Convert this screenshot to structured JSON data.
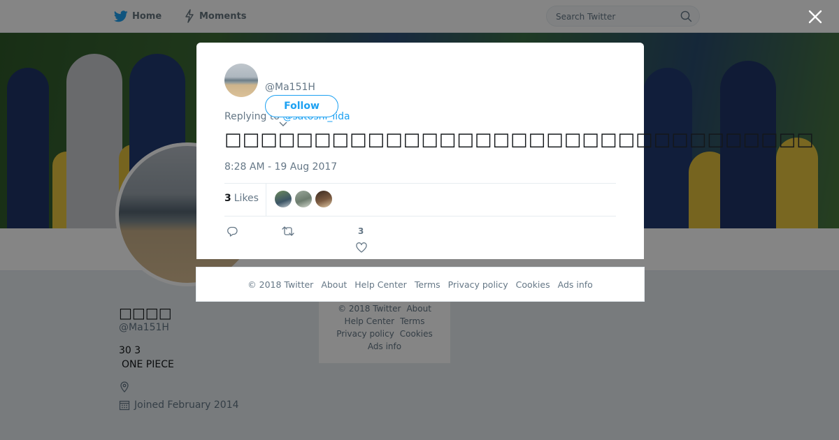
{
  "nav": {
    "home_label": "Home",
    "moments_label": "Moments",
    "search_placeholder": "Search Twitter"
  },
  "profile": {
    "name": "□□□□",
    "handle": "@Ma151H",
    "bio_line1": "30 3",
    "bio_line2": "ONE PIECE",
    "joined": "Joined February 2014"
  },
  "side_footer": {
    "copyright": "© 2018 Twitter",
    "about": "About",
    "help": "Help Center",
    "terms": "Terms",
    "privacy": "Privacy policy",
    "cookies": "Cookies",
    "ads": "Ads info"
  },
  "tweet": {
    "handle": "@Ma151H",
    "follow_label": "Follow",
    "replying_prefix": "Replying to",
    "replying_to": "@satoshi_iida",
    "text": "□□□□□□□□□□□□□□□□□□□□□□□□□□□□□□□□□",
    "time": "8:28 AM - 19 Aug 2017",
    "likes_count": "3",
    "likes_word": "Likes",
    "like_action_count": "3"
  },
  "modal_footer": {
    "copyright": "© 2018 Twitter",
    "about": "About",
    "help": "Help Center",
    "terms": "Terms",
    "privacy": "Privacy policy",
    "cookies": "Cookies",
    "ads": "Ads info"
  },
  "colors": {
    "brand": "#1da1f2",
    "text_primary": "#14171a",
    "text_secondary": "#657786"
  },
  "icons": [
    "twitter-bird-icon",
    "lightning-icon",
    "search-icon",
    "close-icon",
    "chevron-down-icon",
    "location-icon",
    "calendar-icon",
    "reply-icon",
    "retweet-icon",
    "heart-icon"
  ]
}
